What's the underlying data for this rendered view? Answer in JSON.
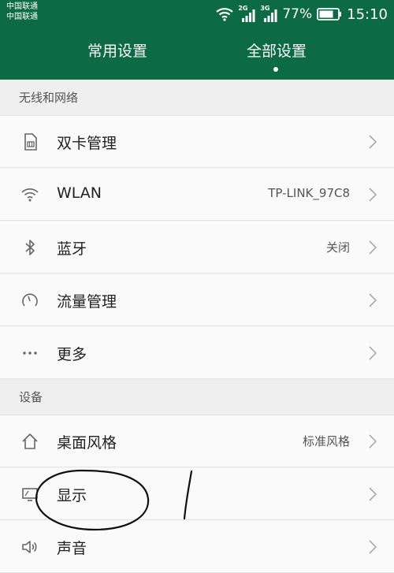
{
  "status_bar": {
    "carrier_1": "中国联通",
    "carrier_2": "中国联通",
    "sim1_network": "2G",
    "sim2_network": "3G",
    "battery_percent": "77%",
    "time": "15:10"
  },
  "tabs": [
    {
      "label": "常用设置",
      "active": false
    },
    {
      "label": "全部设置",
      "active": true
    }
  ],
  "sections": [
    {
      "title": "无线和网络",
      "items": [
        {
          "label": "双卡管理",
          "value": "",
          "icon": "sim-card-icon"
        },
        {
          "label": "WLAN",
          "value": "TP-LINK_97C8",
          "icon": "wifi-icon"
        },
        {
          "label": "蓝牙",
          "value": "关闭",
          "icon": "bluetooth-icon"
        },
        {
          "label": "流量管理",
          "value": "",
          "icon": "data-usage-icon"
        },
        {
          "label": "更多",
          "value": "",
          "icon": "more-dots-icon"
        }
      ]
    },
    {
      "title": "设备",
      "items": [
        {
          "label": "桌面风格",
          "value": "标准风格",
          "icon": "home-icon"
        },
        {
          "label": "显示",
          "value": "",
          "icon": "display-icon"
        },
        {
          "label": "声音",
          "value": "",
          "icon": "speaker-icon"
        }
      ]
    }
  ],
  "colors": {
    "header_bg": "#0c6a44",
    "section_bg": "#efefef",
    "row_bg": "#fafafa",
    "annotation_ink": "#111111"
  }
}
